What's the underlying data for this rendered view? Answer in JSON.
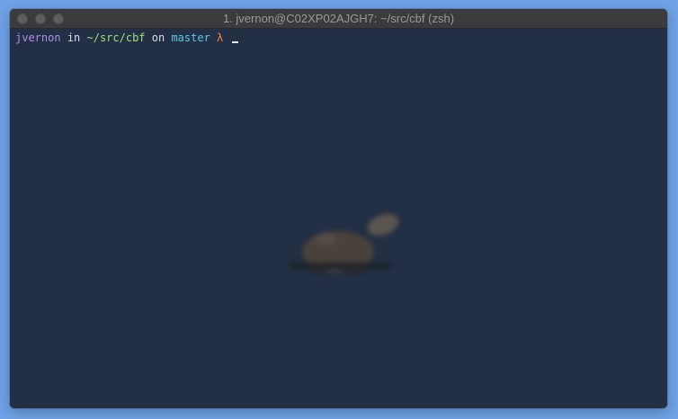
{
  "window": {
    "title": "1. jvernon@C02XP02AJGH7: ~/src/cbf (zsh)"
  },
  "prompt": {
    "user": "jvernon",
    "in_word": "in",
    "path": "~/src/cbf",
    "on_word": "on",
    "branch": "master",
    "symbol": "λ"
  },
  "colors": {
    "desktop": "#6fa2e6",
    "terminal_bg": "#222f44",
    "user": "#b48cf0",
    "path": "#9fe07a",
    "branch": "#5fc8ea",
    "symbol": "#f4884a"
  },
  "background_image": {
    "icon": "platypus-logo-icon"
  }
}
